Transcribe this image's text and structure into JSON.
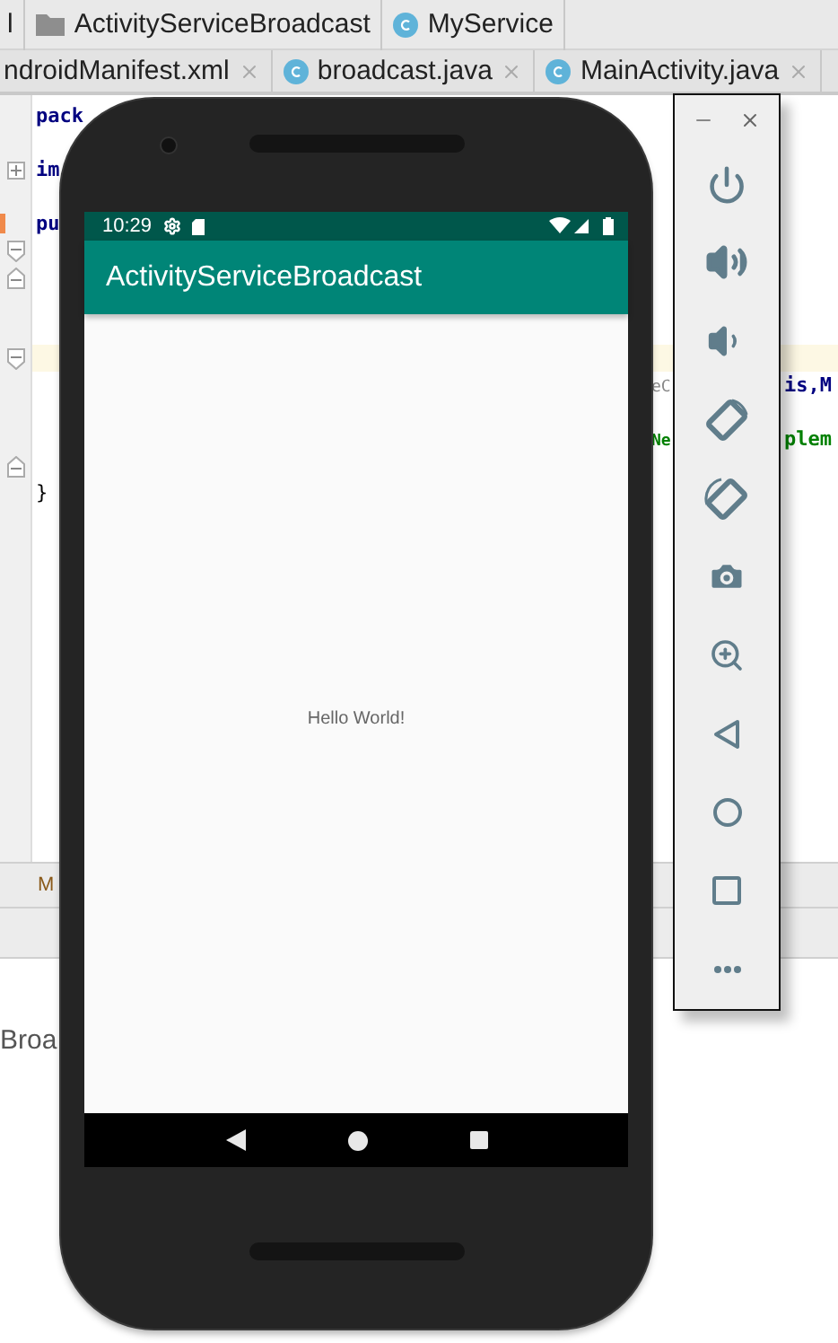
{
  "breadcrumbs": [
    {
      "label": "l"
    },
    {
      "label": "ActivityServiceBroadcast"
    },
    {
      "label": "MyService"
    }
  ],
  "editor_tabs": [
    {
      "label": "ndroidManifest.xml",
      "selected": false
    },
    {
      "label": "broadcast.java",
      "selected": false
    },
    {
      "label": "MainActivity.java",
      "selected": false
    }
  ],
  "code_lines": [
    {
      "kind": "plain",
      "current": false,
      "changed": false,
      "main": {
        "text": "pack",
        "kind": "keyword"
      }
    },
    {
      "kind": "plain",
      "current": false,
      "changed": false
    },
    {
      "kind": "collapsed",
      "current": false,
      "changed": false,
      "main": {
        "text": "im",
        "kind": "keyword"
      }
    },
    {
      "kind": "plain",
      "current": false,
      "changed": false
    },
    {
      "kind": "plain",
      "current": false,
      "changed": true,
      "main": {
        "text": "pu",
        "kind": "keyword"
      }
    },
    {
      "kind": "fold-start",
      "current": false,
      "changed": false
    },
    {
      "kind": "fold-end",
      "current": false,
      "changed": false
    },
    {
      "kind": "plain",
      "current": false,
      "changed": false
    },
    {
      "kind": "plain",
      "current": false,
      "changed": false
    },
    {
      "kind": "fold-start",
      "current": true,
      "changed": false
    },
    {
      "kind": "plain",
      "current": false,
      "changed": false,
      "mid": {
        "text": "eC",
        "kind": "hint"
      },
      "right": {
        "text": "is,M",
        "kind": "keyword"
      }
    },
    {
      "kind": "plain",
      "current": false,
      "changed": false
    },
    {
      "kind": "plain",
      "current": false,
      "changed": false,
      "mid": {
        "text": "Ne",
        "kind": "string"
      },
      "right": {
        "text": "plem",
        "kind": "string"
      }
    },
    {
      "kind": "fold-end",
      "current": false,
      "changed": false
    },
    {
      "kind": "plain",
      "current": false,
      "changed": false,
      "main": {
        "text": "}",
        "kind": "plain"
      }
    }
  ],
  "tool_tab": {
    "label": "M"
  },
  "run_panel": {
    "text": "Broa"
  },
  "phone": {
    "status_bar": {
      "time": "10:29"
    },
    "app_bar": {
      "title": "ActivityServiceBroadcast"
    },
    "content": {
      "text": "Hello World!"
    }
  },
  "emulator_toolbar": {
    "buttons": [
      {
        "kind": "power"
      },
      {
        "kind": "volume-up"
      },
      {
        "kind": "volume-down"
      },
      {
        "kind": "rotate-left"
      },
      {
        "kind": "rotate-right"
      },
      {
        "kind": "screenshot"
      },
      {
        "kind": "zoom"
      },
      {
        "kind": "back"
      },
      {
        "kind": "home"
      },
      {
        "kind": "overview"
      },
      {
        "kind": "more"
      }
    ]
  }
}
